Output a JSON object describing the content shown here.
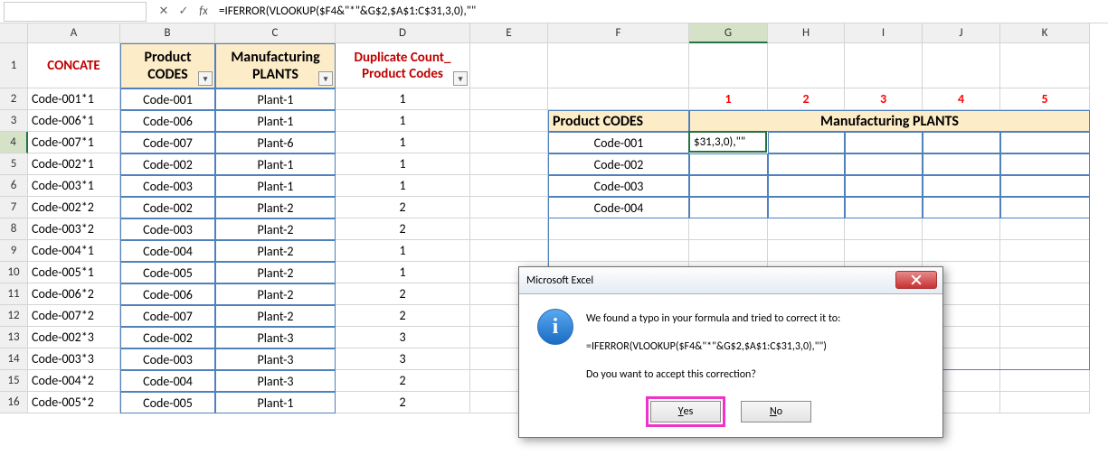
{
  "formula_bar": {
    "name_box": "",
    "cancel": "✕",
    "confirm": "✓",
    "fx": "fx",
    "formula": "=IFERROR(VLOOKUP($F4&\"*\"&G$2,$A$1:C$31,3,0),\"\""
  },
  "col_headers": [
    "A",
    "B",
    "C",
    "D",
    "E",
    "F",
    "G",
    "H",
    "I",
    "J",
    "K"
  ],
  "row_headers": [
    "1",
    "2",
    "3",
    "4",
    "5",
    "6",
    "7",
    "8",
    "9",
    "10",
    "11",
    "12",
    "13",
    "14",
    "15",
    "16"
  ],
  "headers": {
    "a1": "CONCATE",
    "b1a": "Product",
    "b1b": "CODES",
    "c1a": "Manufacturing",
    "c1b": "PLANTS",
    "d1a": "Duplicate Count_",
    "d1b": "Product Codes",
    "f3": "Product CODES",
    "g3": "Manufacturing PLANTS",
    "num1": "1",
    "num2": "2",
    "num3": "3",
    "num4": "4",
    "num5": "5"
  },
  "rows": [
    {
      "a": "Code-001*1",
      "b": "Code-001",
      "c": "Plant-1",
      "d": "1"
    },
    {
      "a": "Code-006*1",
      "b": "Code-006",
      "c": "Plant-1",
      "d": "1"
    },
    {
      "a": "Code-007*1",
      "b": "Code-007",
      "c": "Plant-6",
      "d": "1"
    },
    {
      "a": "Code-002*1",
      "b": "Code-002",
      "c": "Plant-1",
      "d": "1"
    },
    {
      "a": "Code-003*1",
      "b": "Code-003",
      "c": "Plant-1",
      "d": "1"
    },
    {
      "a": "Code-002*2",
      "b": "Code-002",
      "c": "Plant-2",
      "d": "2"
    },
    {
      "a": "Code-003*2",
      "b": "Code-003",
      "c": "Plant-2",
      "d": "2"
    },
    {
      "a": "Code-004*1",
      "b": "Code-004",
      "c": "Plant-2",
      "d": "1"
    },
    {
      "a": "Code-005*1",
      "b": "Code-005",
      "c": "Plant-2",
      "d": "1"
    },
    {
      "a": "Code-006*2",
      "b": "Code-006",
      "c": "Plant-2",
      "d": "2"
    },
    {
      "a": "Code-007*2",
      "b": "Code-007",
      "c": "Plant-2",
      "d": "2"
    },
    {
      "a": "Code-002*3",
      "b": "Code-002",
      "c": "Plant-3",
      "d": "3"
    },
    {
      "a": "Code-003*3",
      "b": "Code-003",
      "c": "Plant-3",
      "d": "3"
    },
    {
      "a": "Code-004*2",
      "b": "Code-004",
      "c": "Plant-3",
      "d": "2"
    },
    {
      "a": "Code-005*2",
      "b": "Code-005",
      "c": "Plant-1",
      "d": "2"
    }
  ],
  "f_col": [
    "Code-001",
    "Code-002",
    "Code-003",
    "Code-004"
  ],
  "active_cell": "$31,3,0),\"\"",
  "dialog": {
    "title": "Microsoft Excel",
    "line1": "We found a typo in your formula and tried to correct it to:",
    "line2": "=IFERROR(VLOOKUP($F4&\"*\"&G$2,$A$1:C$31,3,0),\"\")",
    "line3": "Do you want to accept this correction?",
    "yes": "Yes",
    "no": "No"
  }
}
